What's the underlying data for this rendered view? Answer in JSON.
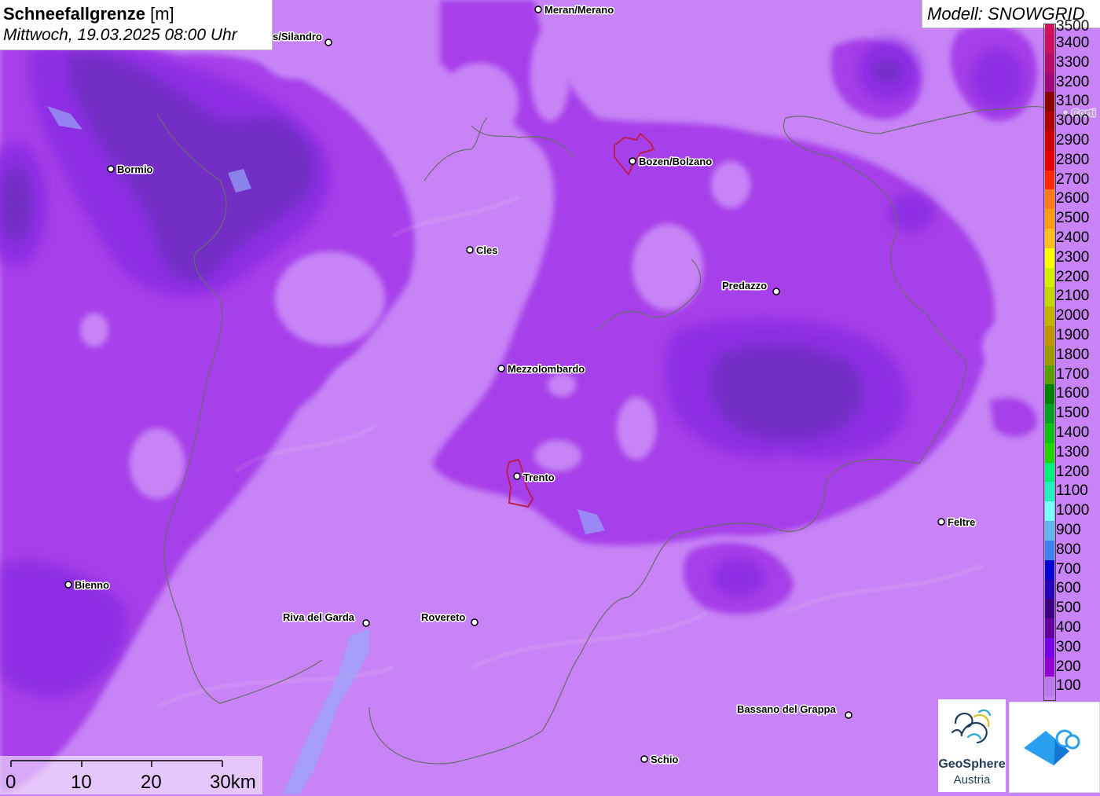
{
  "title": {
    "main": "Schneefallgrenze",
    "unit": "[m]",
    "subtitle": "Mittwoch, 19.03.2025 08:00 Uhr"
  },
  "model": "Modell: SNOWGRID",
  "legend": {
    "partial_top": "3500",
    "entries": [
      {
        "value": "3400",
        "color": "#c8105e"
      },
      {
        "value": "3300",
        "color": "#b40c6a"
      },
      {
        "value": "3200",
        "color": "#a00a78"
      },
      {
        "value": "3100",
        "color": "#8c0000"
      },
      {
        "value": "3000",
        "color": "#b00000"
      },
      {
        "value": "2900",
        "color": "#cc0000"
      },
      {
        "value": "2800",
        "color": "#e60000"
      },
      {
        "value": "2700",
        "color": "#ff2a00"
      },
      {
        "value": "2600",
        "color": "#ff7a1a"
      },
      {
        "value": "2500",
        "color": "#ff9c14"
      },
      {
        "value": "2400",
        "color": "#ffbe1e"
      },
      {
        "value": "2300",
        "color": "#ffff00"
      },
      {
        "value": "2200",
        "color": "#d4f000"
      },
      {
        "value": "2100",
        "color": "#c2d600"
      },
      {
        "value": "2000",
        "color": "#c4b400"
      },
      {
        "value": "1900",
        "color": "#c09400"
      },
      {
        "value": "1800",
        "color": "#9c9a00"
      },
      {
        "value": "1700",
        "color": "#5a9e00"
      },
      {
        "value": "1600",
        "color": "#008000"
      },
      {
        "value": "1500",
        "color": "#00a020"
      },
      {
        "value": "1400",
        "color": "#10c010"
      },
      {
        "value": "1300",
        "color": "#22d400"
      },
      {
        "value": "1200",
        "color": "#00f07a"
      },
      {
        "value": "1100",
        "color": "#20f0c0"
      },
      {
        "value": "1000",
        "color": "#7affff"
      },
      {
        "value": "900",
        "color": "#64b4f0"
      },
      {
        "value": "800",
        "color": "#3c82f0"
      },
      {
        "value": "700",
        "color": "#0000d2"
      },
      {
        "value": "600",
        "color": "#2600b8"
      },
      {
        "value": "500",
        "color": "#3c0082"
      },
      {
        "value": "400",
        "color": "#6400a0"
      },
      {
        "value": "300",
        "color": "#7800e6"
      },
      {
        "value": "200",
        "color": "#9400d2"
      },
      {
        "value": "100",
        "color": "#be78f0"
      }
    ]
  },
  "cities": [
    {
      "name": "Meran/Merano"
    },
    {
      "name": "s/Silandro"
    },
    {
      "name": "Bormio"
    },
    {
      "name": "Bozen/Bolzano"
    },
    {
      "name": "Cles"
    },
    {
      "name": "Predazzo"
    },
    {
      "name": "Mezzolombardo"
    },
    {
      "name": "Trento"
    },
    {
      "name": "Feltre"
    },
    {
      "name": "Bienno"
    },
    {
      "name": "Riva del Garda"
    },
    {
      "name": "Rovereto"
    },
    {
      "name": "Bassano del Grappa"
    },
    {
      "name": "Schio"
    },
    {
      "name": "Corti"
    }
  ],
  "scale": {
    "labels": [
      "0",
      "10",
      "20",
      "30km"
    ]
  },
  "logos": {
    "geosphere_line1": "GeoSphere",
    "geosphere_line2": "Austria"
  }
}
